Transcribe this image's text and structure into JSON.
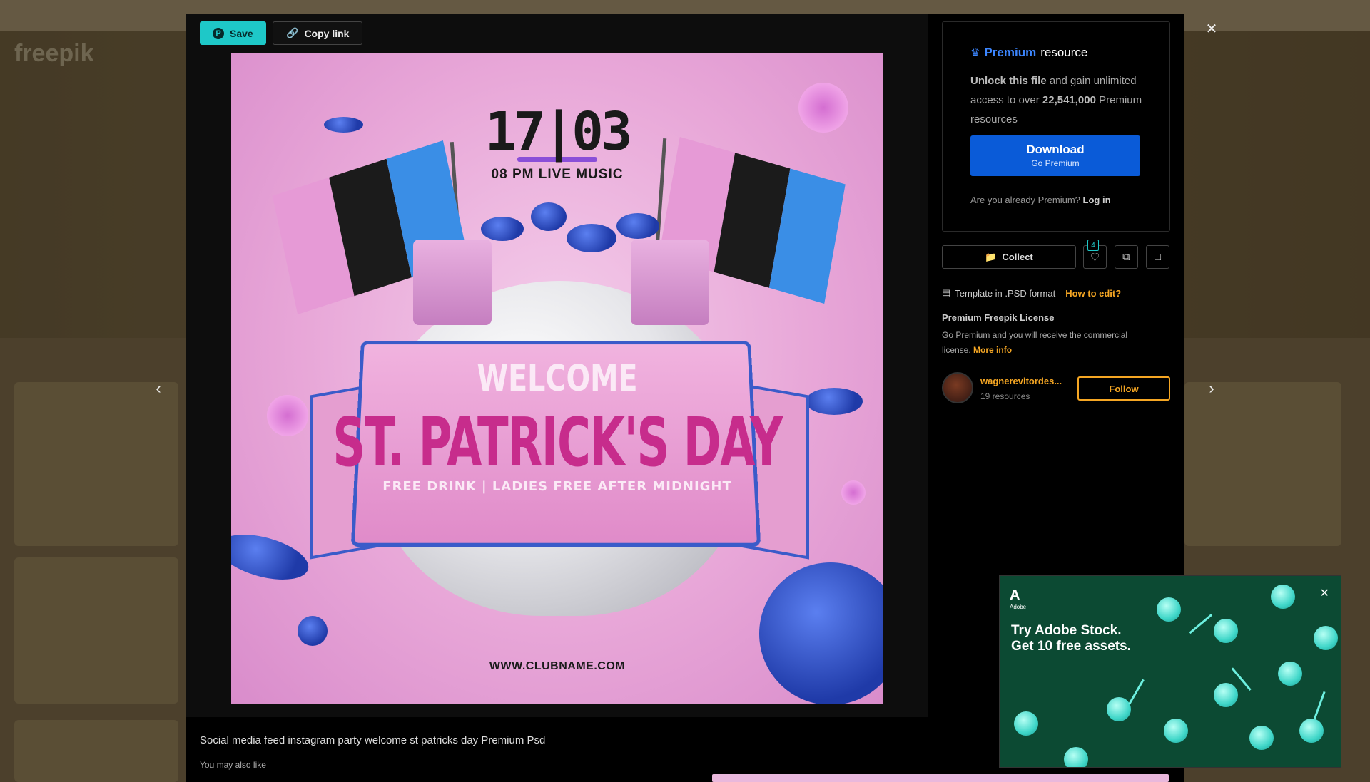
{
  "modal": {
    "save_label": "Save",
    "copy_label": "Copy link",
    "caption": "Social media feed instagram party welcome st patricks day Premium Psd",
    "may_also_like": "You may also like"
  },
  "poster": {
    "date": "17|03",
    "music": "08 PM LIVE MUSIC",
    "welcome": "WELCOME",
    "title": "ST. PATRICK'S DAY",
    "subtitle": "FREE DRINK | LADIES FREE AFTER MIDNIGHT",
    "url": "WWW.CLUBNAME.COM"
  },
  "premium": {
    "title_accent": "Premium",
    "title_rest": "resource",
    "unlock_bold": "Unlock this file",
    "unlock_rest": "and gain unlimited access to over",
    "count": "22,541,000",
    "count_rest": "Premium resources",
    "download_label": "Download",
    "download_sub": "Go Premium",
    "already_text": "Are you already Premium?",
    "login_label": "Log in"
  },
  "actions": {
    "collect_label": "Collect",
    "like_count": "4"
  },
  "info": {
    "template_text": "Template in .PSD format",
    "howto_label": "How to edit?",
    "license_title": "Premium Freepik License",
    "license_text": "Go Premium and you will receive the commercial license.",
    "more_info": "More info"
  },
  "author": {
    "name": "wagnerevitordes...",
    "resources": "19 resources",
    "follow_label": "Follow"
  },
  "ad": {
    "brand": "Adobe",
    "line1": "Try Adobe Stock.",
    "line2": "Get 10 free assets."
  },
  "background": {
    "logo": "freepik"
  },
  "colors": {
    "save": "#1ec8c8",
    "premium_blue": "#0a5bd8",
    "accent_orange": "#f5a623",
    "ad_bg": "#0c4a33"
  }
}
